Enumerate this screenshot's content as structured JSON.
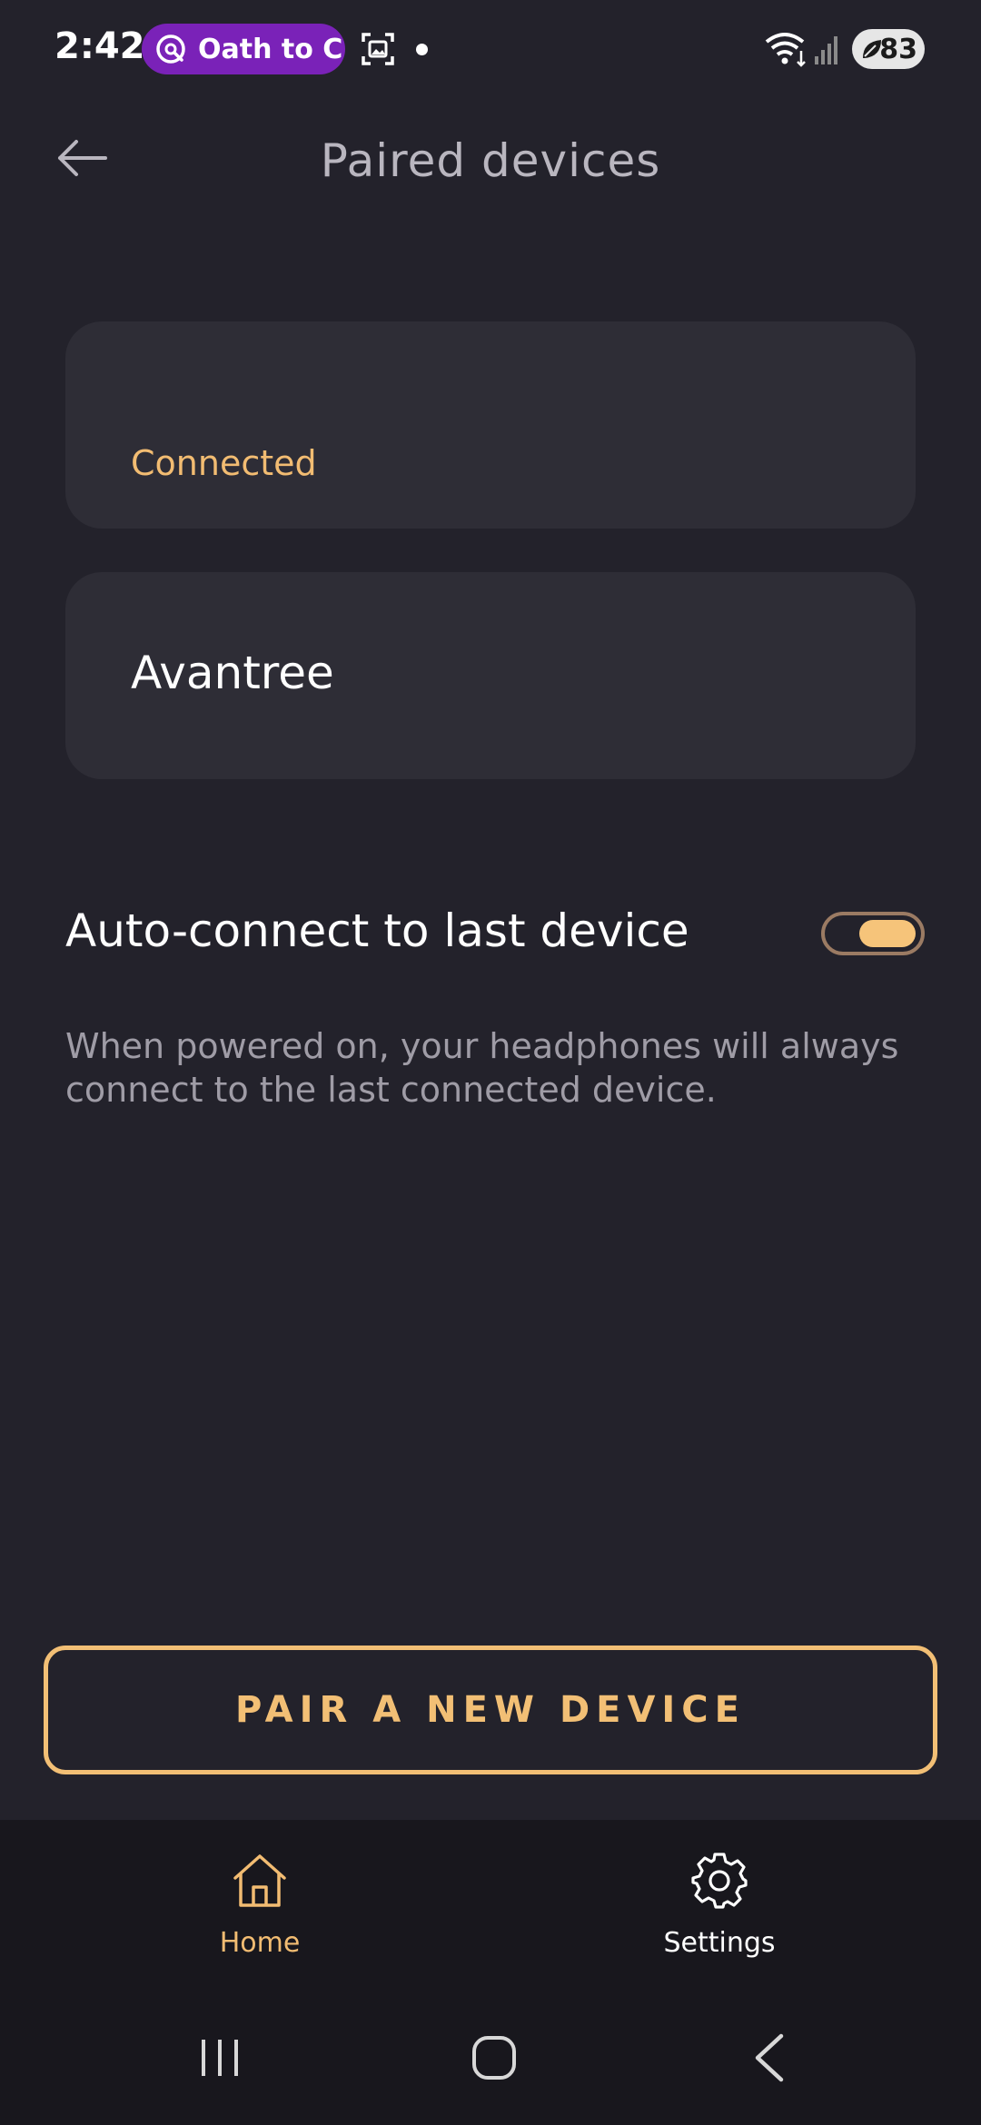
{
  "status_bar": {
    "time": "2:42",
    "media_pill": "Oath to C",
    "battery": "83"
  },
  "header": {
    "title": "Paired devices"
  },
  "devices": [
    {
      "name": "",
      "status": "Connected"
    },
    {
      "name": "Avantree",
      "status": ""
    }
  ],
  "auto_connect": {
    "label": "Auto-connect to last device",
    "enabled": true,
    "description": "When powered on, your headphones will always connect to the last connected device."
  },
  "pair_button": {
    "label": "PAIR A NEW DEVICE"
  },
  "bottom_nav": {
    "items": [
      {
        "label": "Home",
        "icon": "home-icon",
        "active": true
      },
      {
        "label": "Settings",
        "icon": "gear-icon",
        "active": false
      }
    ]
  },
  "colors": {
    "background": "#23222b",
    "card": "#2e2d36",
    "accent": "#f2bc72",
    "nav_background": "#18171d"
  }
}
